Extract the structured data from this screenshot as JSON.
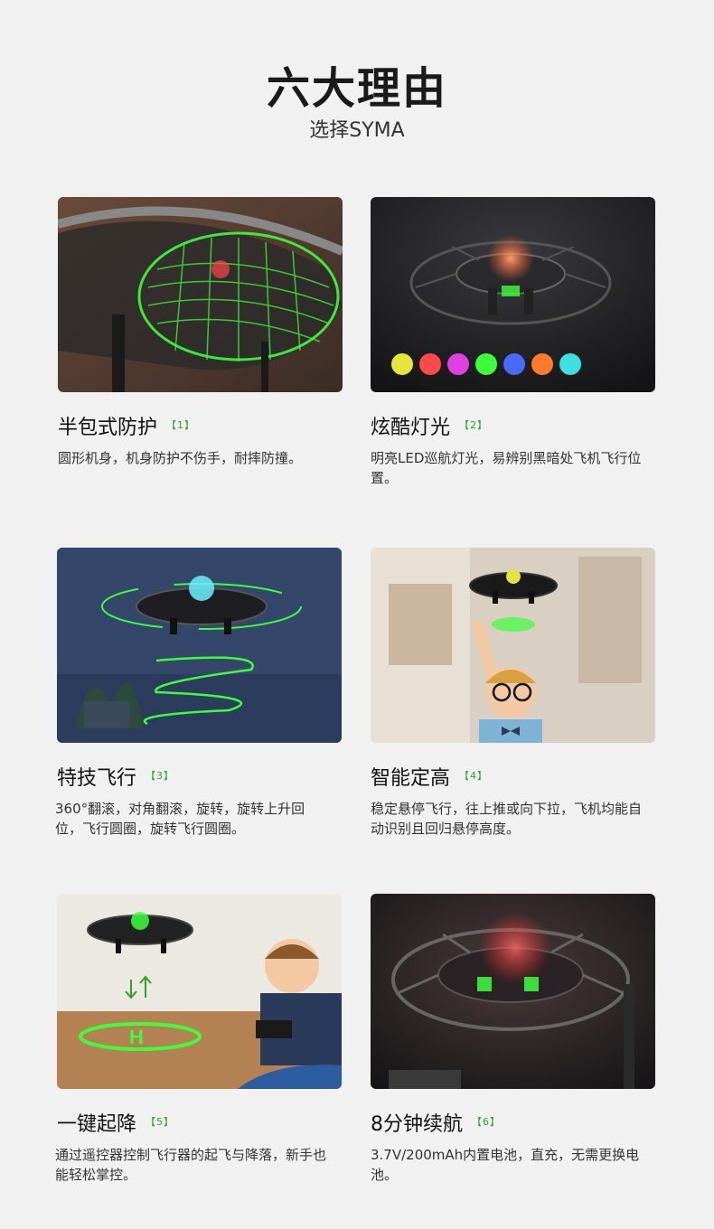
{
  "header": {
    "title": "六大理由",
    "subtitle": "选择SYMA"
  },
  "features": [
    {
      "title": "半包式防护",
      "ref": "【1】",
      "desc": "圆形机身，机身防护不伤手，耐摔防撞。",
      "image_icon": "guard-ring-image"
    },
    {
      "title": "炫酷灯光",
      "ref": "【2】",
      "desc": "明亮LED巡航灯光，易辨别黑暗处飞机飞行位置。",
      "image_icon": "led-drone-image"
    },
    {
      "title": "特技飞行",
      "ref": "【3】",
      "desc": "360°翻滚，对角翻滚，旋转，旋转上升回位，飞行圆圈，旋转飞行圆圈。",
      "image_icon": "stunt-flight-image"
    },
    {
      "title": "智能定高",
      "ref": "【4】",
      "desc": "稳定悬停飞行，往上推或向下拉，飞机均能自动识别且回归悬停高度。",
      "image_icon": "altitude-hold-image"
    },
    {
      "title": "一键起降",
      "ref": "【5】",
      "desc": "通过遥控器控制飞行器的起飞与降落，新手也能轻松掌控。",
      "image_icon": "takeoff-landing-image"
    },
    {
      "title": "8分钟续航",
      "ref": "【6】",
      "desc": "3.7V/200mAh内置电池，直充，无需更换电池。",
      "image_icon": "battery-drone-image"
    }
  ],
  "colors": {
    "background": "#f1f1f1",
    "accent_green": "#2aa52a",
    "glow_green": "#3cff3c"
  }
}
